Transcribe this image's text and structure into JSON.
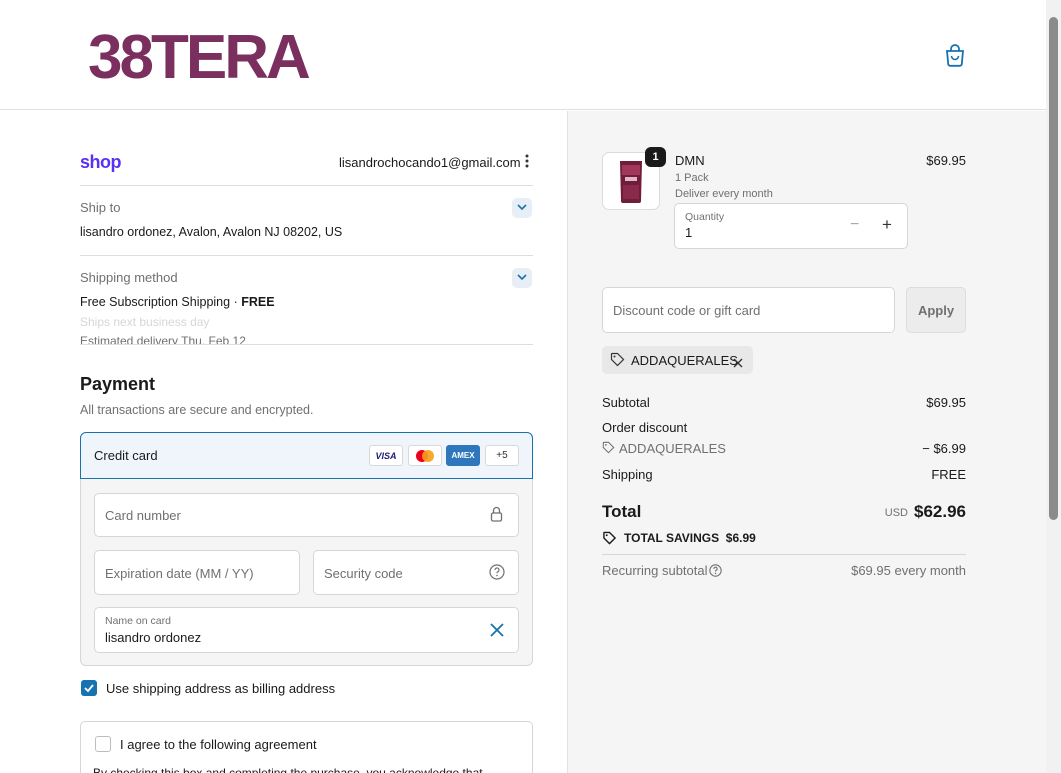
{
  "header": {
    "logo": "38TERA",
    "cart_icon": "shopping-bag-icon"
  },
  "account": {
    "shop_logo": "shop",
    "email": "lisandrochocando1@gmail.com",
    "menu_icon": "kebab-menu-icon"
  },
  "ship_to": {
    "label": "Ship to",
    "value": "lisandro ordonez, Avalon, Avalon NJ 08202, US"
  },
  "shipping_method": {
    "label": "Shipping method",
    "name": "Free Subscription Shipping",
    "separator": " · ",
    "price": "FREE",
    "ships_note": "Ships next business day",
    "delivery": "Estimated delivery Thu, Feb 12"
  },
  "payment": {
    "title": "Payment",
    "subtitle": "All transactions are secure and encrypted.",
    "method_label": "Credit card",
    "card_brands": [
      "VISA",
      "",
      "AMEX",
      "+5"
    ],
    "card_number_placeholder": "Card number",
    "expiry_placeholder": "Expiration date (MM / YY)",
    "security_placeholder": "Security code",
    "name_label": "Name on card",
    "name_value": "lisandro ordonez",
    "billing_checkbox_label": "Use shipping address as billing address",
    "agreement_label": "I agree to the following agreement",
    "agreement_text": "By checking this box and completing the purchase, you acknowledge that"
  },
  "order": {
    "badge_count": "1",
    "product_name": "DMN",
    "variant": "1 Pack",
    "frequency": "Deliver every month",
    "price": "$69.95",
    "quantity_label": "Quantity",
    "quantity_value": "1",
    "minus": "−",
    "plus": "+"
  },
  "discount": {
    "placeholder": "Discount code or gift card",
    "apply_label": "Apply",
    "applied_code": "ADDAQUERALES"
  },
  "summary": {
    "subtotal_label": "Subtotal",
    "subtotal_value": "$69.95",
    "order_discount_label": "Order discount",
    "discount_code": "ADDAQUERALES",
    "discount_value": "− $6.99",
    "shipping_label": "Shipping",
    "shipping_value": "FREE",
    "total_label": "Total",
    "currency": "USD",
    "total_value": "$62.96",
    "savings_label": "TOTAL SAVINGS",
    "savings_value": "$6.99",
    "recurring_label": "Recurring subtotal",
    "recurring_value": "$69.95 every month"
  },
  "colors": {
    "brand": "#7a2f5e",
    "accent": "#1773b0",
    "shop": "#5a31f4"
  }
}
